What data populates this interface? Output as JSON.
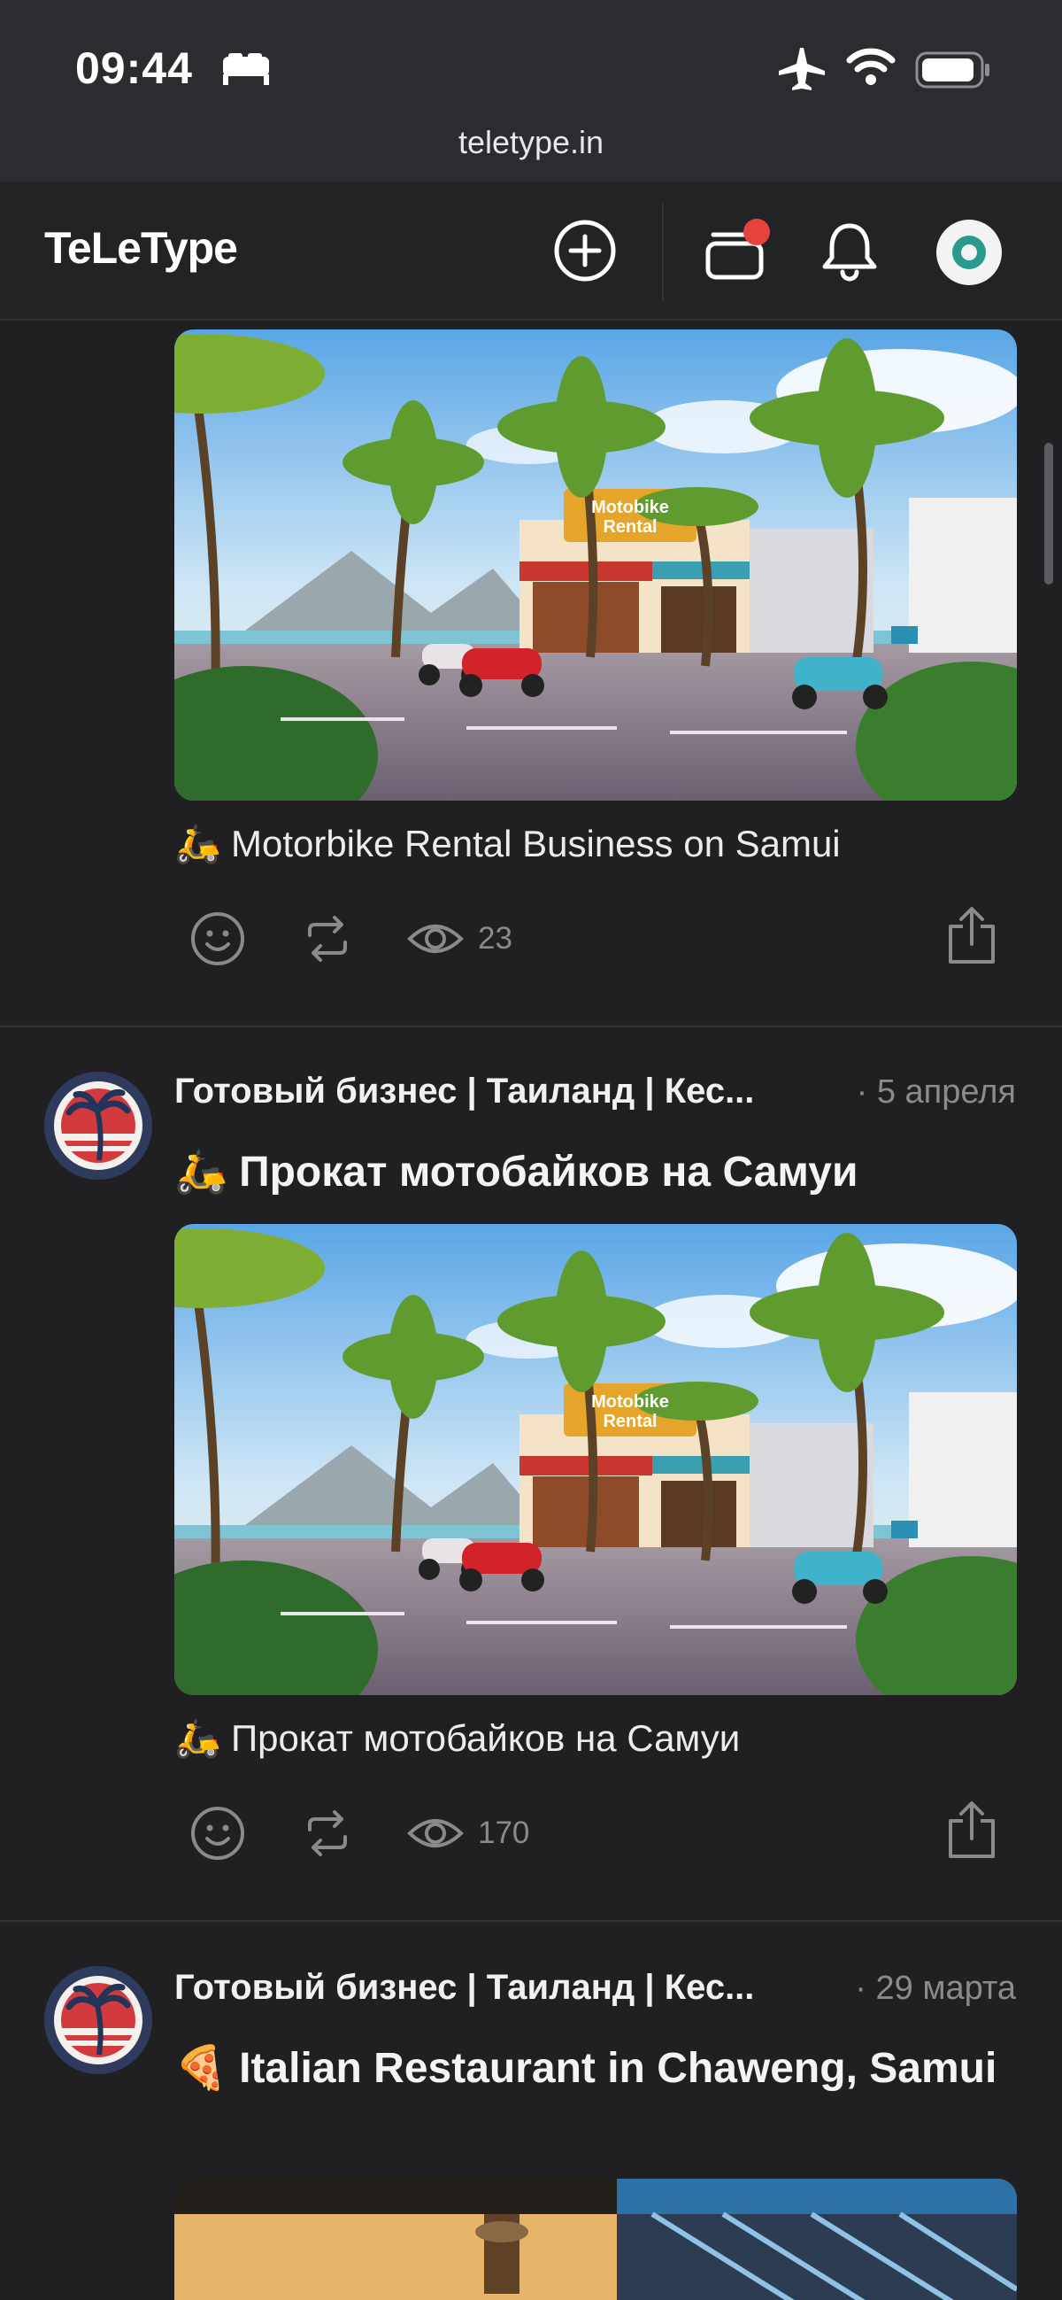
{
  "status_bar": {
    "time": "09:44",
    "icons": [
      "bed-icon",
      "airplane-icon",
      "wifi-icon",
      "battery-icon"
    ]
  },
  "browser": {
    "url": "teletype.in"
  },
  "header": {
    "logo": "TeLeType",
    "buttons": [
      "create-icon",
      "feed-icon",
      "bell-icon",
      "avatar"
    ],
    "notification_dot_color": "#e8423f"
  },
  "posts": [
    {
      "caption_emoji": "🛵",
      "caption": "Motorbike Rental Business on Samui",
      "views": "23"
    },
    {
      "channel": "Готовый бизнес | Таиланд | Кес...",
      "date": "· 5 апреля",
      "title_emoji": "🛵",
      "title": "Прокат мотобайков на Самуи",
      "caption_emoji": "🛵",
      "caption": "Прокат мотобайков на Самуи",
      "views": "170"
    },
    {
      "channel": "Готовый бизнес | Таиланд | Кес...",
      "date": "· 29 марта",
      "title_emoji": "🍕",
      "title": "Italian Restaurant in Chaweng, Samui"
    }
  ],
  "image_sign": {
    "line1": "Motobike",
    "line2": "Rental"
  }
}
